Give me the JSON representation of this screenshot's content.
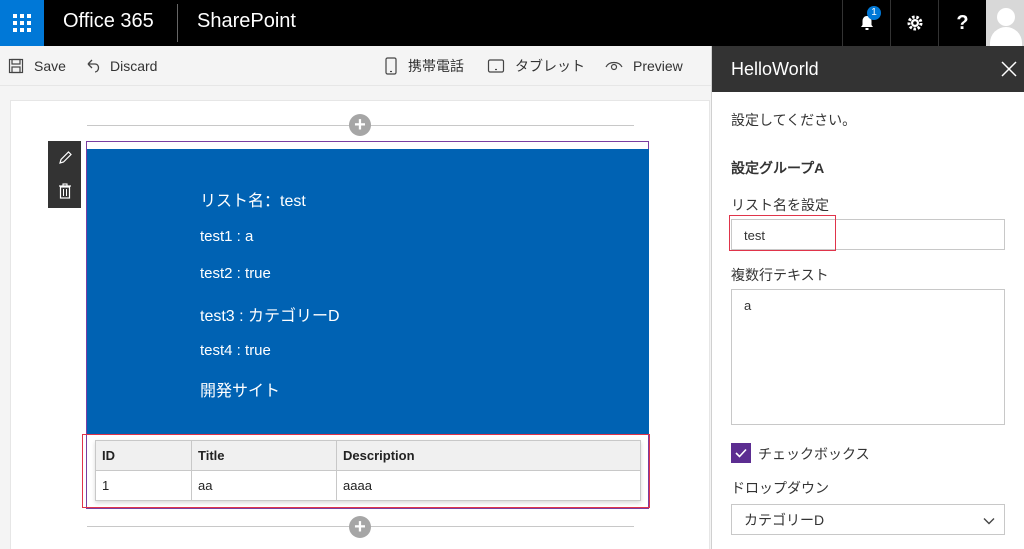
{
  "suite": {
    "brand": "Office 365",
    "app": "SharePoint",
    "notification_count": "1",
    "help_label": "?"
  },
  "commands": {
    "save": "Save",
    "discard": "Discard",
    "mobile": "携帯電話",
    "tablet": "タブレット",
    "preview": "Preview"
  },
  "webpart": {
    "lines": [
      "リスト名：test",
      "test1 : a",
      "test2 : true",
      "test3 : カテゴリーD",
      "test4 : true",
      "開発サイト"
    ],
    "table": {
      "headers": [
        "ID",
        "Title",
        "Description"
      ],
      "rows": [
        [
          "1",
          "aa",
          "aaaa"
        ]
      ]
    }
  },
  "pane": {
    "title": "HelloWorld",
    "description": "設定してください。",
    "group": "設定グループA",
    "list_name_label": "リスト名を設定",
    "list_name_value": "test",
    "multiline_label": "複数行テキスト",
    "multiline_value": "a",
    "checkbox_label": "チェックボックス",
    "checkbox_checked": true,
    "dropdown_label": "ドロップダウン",
    "dropdown_value": "カテゴリーD"
  },
  "colors": {
    "accent": "#0078d7",
    "webpart_bg": "#0062b3",
    "checkbox": "#5c2d91",
    "highlight": "#e0344a"
  }
}
